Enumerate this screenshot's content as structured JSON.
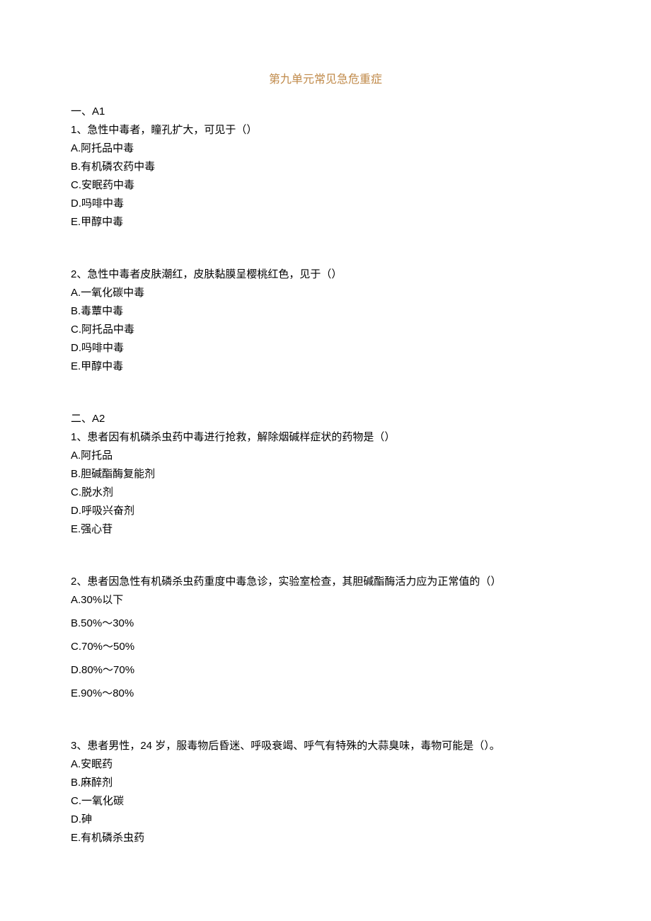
{
  "title": "第九单元常见急危重症",
  "sections": [
    {
      "header": "一、A1",
      "questions": [
        {
          "stem": "1、急性中毒者，瞳孔扩大，可见于（）",
          "options": [
            "A.阿托品中毒",
            "B.有机磷农药中毒",
            "C.安眠药中毒",
            "D.吗啡中毒",
            "E.甲醇中毒"
          ],
          "wide": false
        },
        {
          "stem": "2、急性中毒者皮肤潮红，皮肤黏膜呈樱桃红色，见于（）",
          "options": [
            "A.一氧化碳中毒",
            "B.毒蕈中毒",
            "C.阿托品中毒",
            "D.吗啡中毒",
            "E.甲醇中毒"
          ],
          "wide": false
        }
      ]
    },
    {
      "header": "二、A2",
      "questions": [
        {
          "stem": "1、患者因有机磷杀虫药中毒进行抢救，解除烟碱样症状的药物是（）",
          "options": [
            "A.阿托品",
            "B.胆碱酯酶复能剂",
            "C.脱水剂",
            "D.呼吸兴奋剂",
            "E.强心苷"
          ],
          "wide": false
        },
        {
          "stem": "2、患者因急性有机磷杀虫药重度中毒急诊，实验室检查，其胆碱酯酶活力应为正常值的（）",
          "options": [
            "A.30%以下",
            "B.50%～30%",
            "C.70%～50%",
            "D.80%～70%",
            "E.90%～80%"
          ],
          "wide": true
        },
        {
          "stem": "3、患者男性，24 岁，服毒物后昏迷、呼吸衰竭、呼气有特殊的大蒜臭味，毒物可能是（）。",
          "options": [
            "A.安眠药",
            "B.麻醉剂",
            "C.一氧化碳",
            "D.砷",
            "E.有机磷杀虫药"
          ],
          "wide": false
        }
      ]
    }
  ]
}
